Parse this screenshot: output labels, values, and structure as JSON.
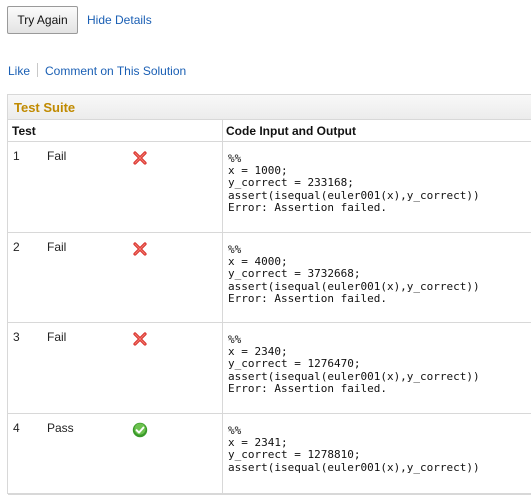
{
  "toolbar": {
    "try_again_label": "Try Again",
    "hide_details_label": "Hide Details"
  },
  "social": {
    "like_label": "Like",
    "comment_label": "Comment on This Solution"
  },
  "suite": {
    "title": "Test Suite",
    "col_test": "Test",
    "col_code": "Code Input and Output",
    "tests": [
      {
        "num": "1",
        "status": "Fail",
        "icon": "fail-x-icon",
        "code": "%%\nx = 1000;\ny_correct = 233168;\nassert(isequal(euler001(x),y_correct))\nError: Assertion failed."
      },
      {
        "num": "2",
        "status": "Fail",
        "icon": "fail-x-icon",
        "code": "%%\nx = 4000;\ny_correct = 3732668;\nassert(isequal(euler001(x),y_correct))\nError: Assertion failed."
      },
      {
        "num": "3",
        "status": "Fail",
        "icon": "fail-x-icon",
        "code": "%%\nx = 2340;\ny_correct = 1276470;\nassert(isequal(euler001(x),y_correct))\nError: Assertion failed."
      },
      {
        "num": "4",
        "status": "Pass",
        "icon": "pass-check-icon",
        "code": "%%\nx = 2341;\ny_correct = 1278810;\nassert(isequal(euler001(x),y_correct))"
      }
    ]
  },
  "colors": {
    "fail": "#d9302b",
    "pass": "#3a9a2a",
    "link": "#1a5fb4",
    "title": "#c08a00"
  }
}
